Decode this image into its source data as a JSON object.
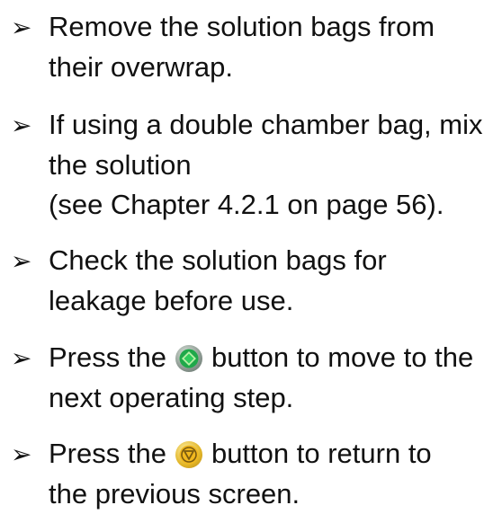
{
  "steps": [
    {
      "arrow": "➢",
      "lines": [
        "Remove the solution bags from",
        "their overwrap."
      ]
    },
    {
      "arrow": "➢",
      "lines": [
        "If using a double chamber bag, mix",
        "the solution",
        "(see Chapter 4.2.1 on page 56)."
      ]
    },
    {
      "arrow": "➢",
      "lines": [
        "Check the solution bags for",
        "leakage before use."
      ]
    },
    {
      "arrow": "➢",
      "line1_before": "Press the",
      "line1_after": "button to move to the",
      "line2": "next operating step.",
      "button_icon": "green-start-button-icon",
      "button_color": "#1fa84a"
    },
    {
      "arrow": "➢",
      "line1_before": "Press the",
      "line1_after": "button to return to",
      "line2": "the previous screen.",
      "button_icon": "yellow-back-button-icon",
      "button_color": "#f1b81f"
    }
  ]
}
